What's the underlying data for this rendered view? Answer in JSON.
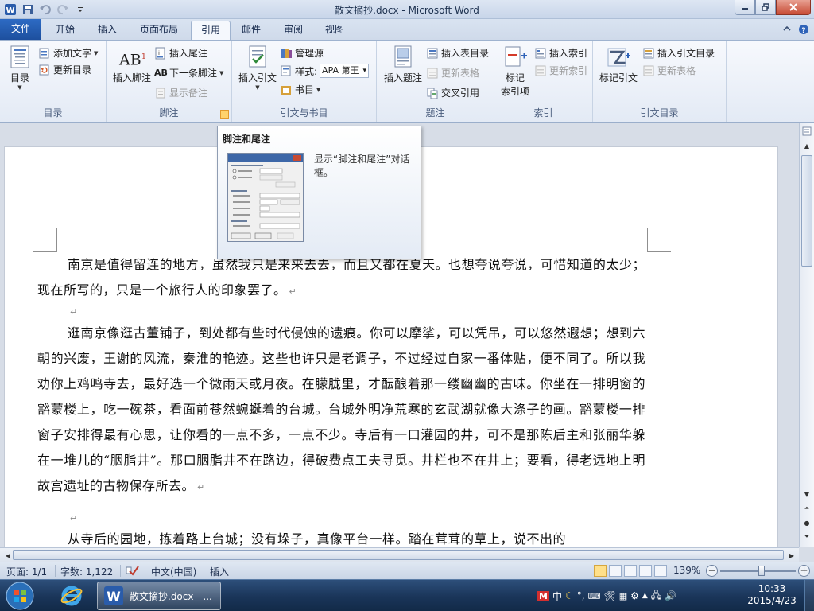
{
  "window": {
    "title": "散文摘抄.docx - Microsoft Word"
  },
  "tabs": [
    {
      "label": "文件"
    },
    {
      "label": "开始"
    },
    {
      "label": "插入"
    },
    {
      "label": "页面布局"
    },
    {
      "label": "引用"
    },
    {
      "label": "邮件"
    },
    {
      "label": "审阅"
    },
    {
      "label": "视图"
    }
  ],
  "ribbon": {
    "toc": {
      "group_label": "目录",
      "toc_button": "目录",
      "add_text": "添加文字",
      "update_toc": "更新目录"
    },
    "footnotes": {
      "group_label": "脚注",
      "insert_footnote": "插入脚注",
      "insert_endnote": "插入尾注",
      "next_footnote": "下一条脚注",
      "show_notes": "显示备注",
      "ab_glyph": "AB",
      "ab_sup": "1",
      "ab_small": "AB"
    },
    "citations": {
      "group_label": "引文与书目",
      "insert_citation": "插入引文",
      "manage_sources": "管理源",
      "style_label": "样式:",
      "style_value": "APA 第王",
      "bibliography": "书目"
    },
    "captions": {
      "group_label": "题注",
      "insert_caption": "插入题注",
      "insert_table_of_figures": "插入表目录",
      "update_table": "更新表格",
      "cross_reference": "交叉引用"
    },
    "index": {
      "group_label": "索引",
      "mark_entry_line1": "标记",
      "mark_entry_line2": "索引项",
      "insert_index": "插入索引",
      "update_index": "更新索引"
    },
    "toa": {
      "group_label": "引文目录",
      "mark_citation": "标记引文",
      "insert_toa": "插入引文目录",
      "update_table": "更新表格"
    }
  },
  "tooltip": {
    "title": "脚注和尾注",
    "description": "显示“脚注和尾注”对话框。"
  },
  "document": {
    "paragraphs": [
      "南京是值得留连的地方，虽然我只是来来去去，而且又都在夏天。也想夸说夸说，可惜知道的太少；现在所写的，只是一个旅行人的印象罢了。",
      "逛南京像逛古董铺子，到处都有些时代侵蚀的遗痕。你可以摩挲，可以凭吊，可以悠然遐想；想到六朝的兴废，王谢的风流，秦淮的艳迹。这些也许只是老调子，不过经过自家一番体贴，便不同了。所以我劝你上鸡鸣寺去，最好选一个微雨天或月夜。在朦胧里，才酝酿着那一缕幽幽的古味。你坐在一排明窗的豁蒙楼上，吃一碗茶，看面前苍然蜿蜒着的台城。台城外明净荒寒的玄武湖就像大涤子的画。豁蒙楼一排窗子安排得最有心思，让你看的一点不多，一点不少。寺后有一口灌园的井，可不是那陈后主和张丽华躲在一堆儿的“胭脂井”。那口胭脂井不在路边，得破费点工夫寻觅。井栏也不在井上；要看，得老远地上明故宫遗址的古物保存所去。",
      "从寺后的园地，拣着路上台城；没有垛子，真像平台一样。踏在茸茸的草上，说不出的"
    ],
    "paragraph_mark": "↵"
  },
  "statusbar": {
    "page": "页面: 1/1",
    "word_count": "字数: 1,122",
    "language": "中文(中国)",
    "mode": "插入",
    "zoom": "139%",
    "zoom_minus": "−",
    "zoom_plus": "+"
  },
  "taskbar": {
    "word_app_label": "散文摘抄.docx - ...",
    "tray_ime": "中",
    "tray_punct": "°,",
    "time": "10:33",
    "date": "2015/4/23"
  },
  "colors": {
    "file_tab": "#2d6bc4",
    "ribbon_bg": "#e3eaf5",
    "taskbar": "#1a3559",
    "accent_orange": "#e29a2e"
  }
}
